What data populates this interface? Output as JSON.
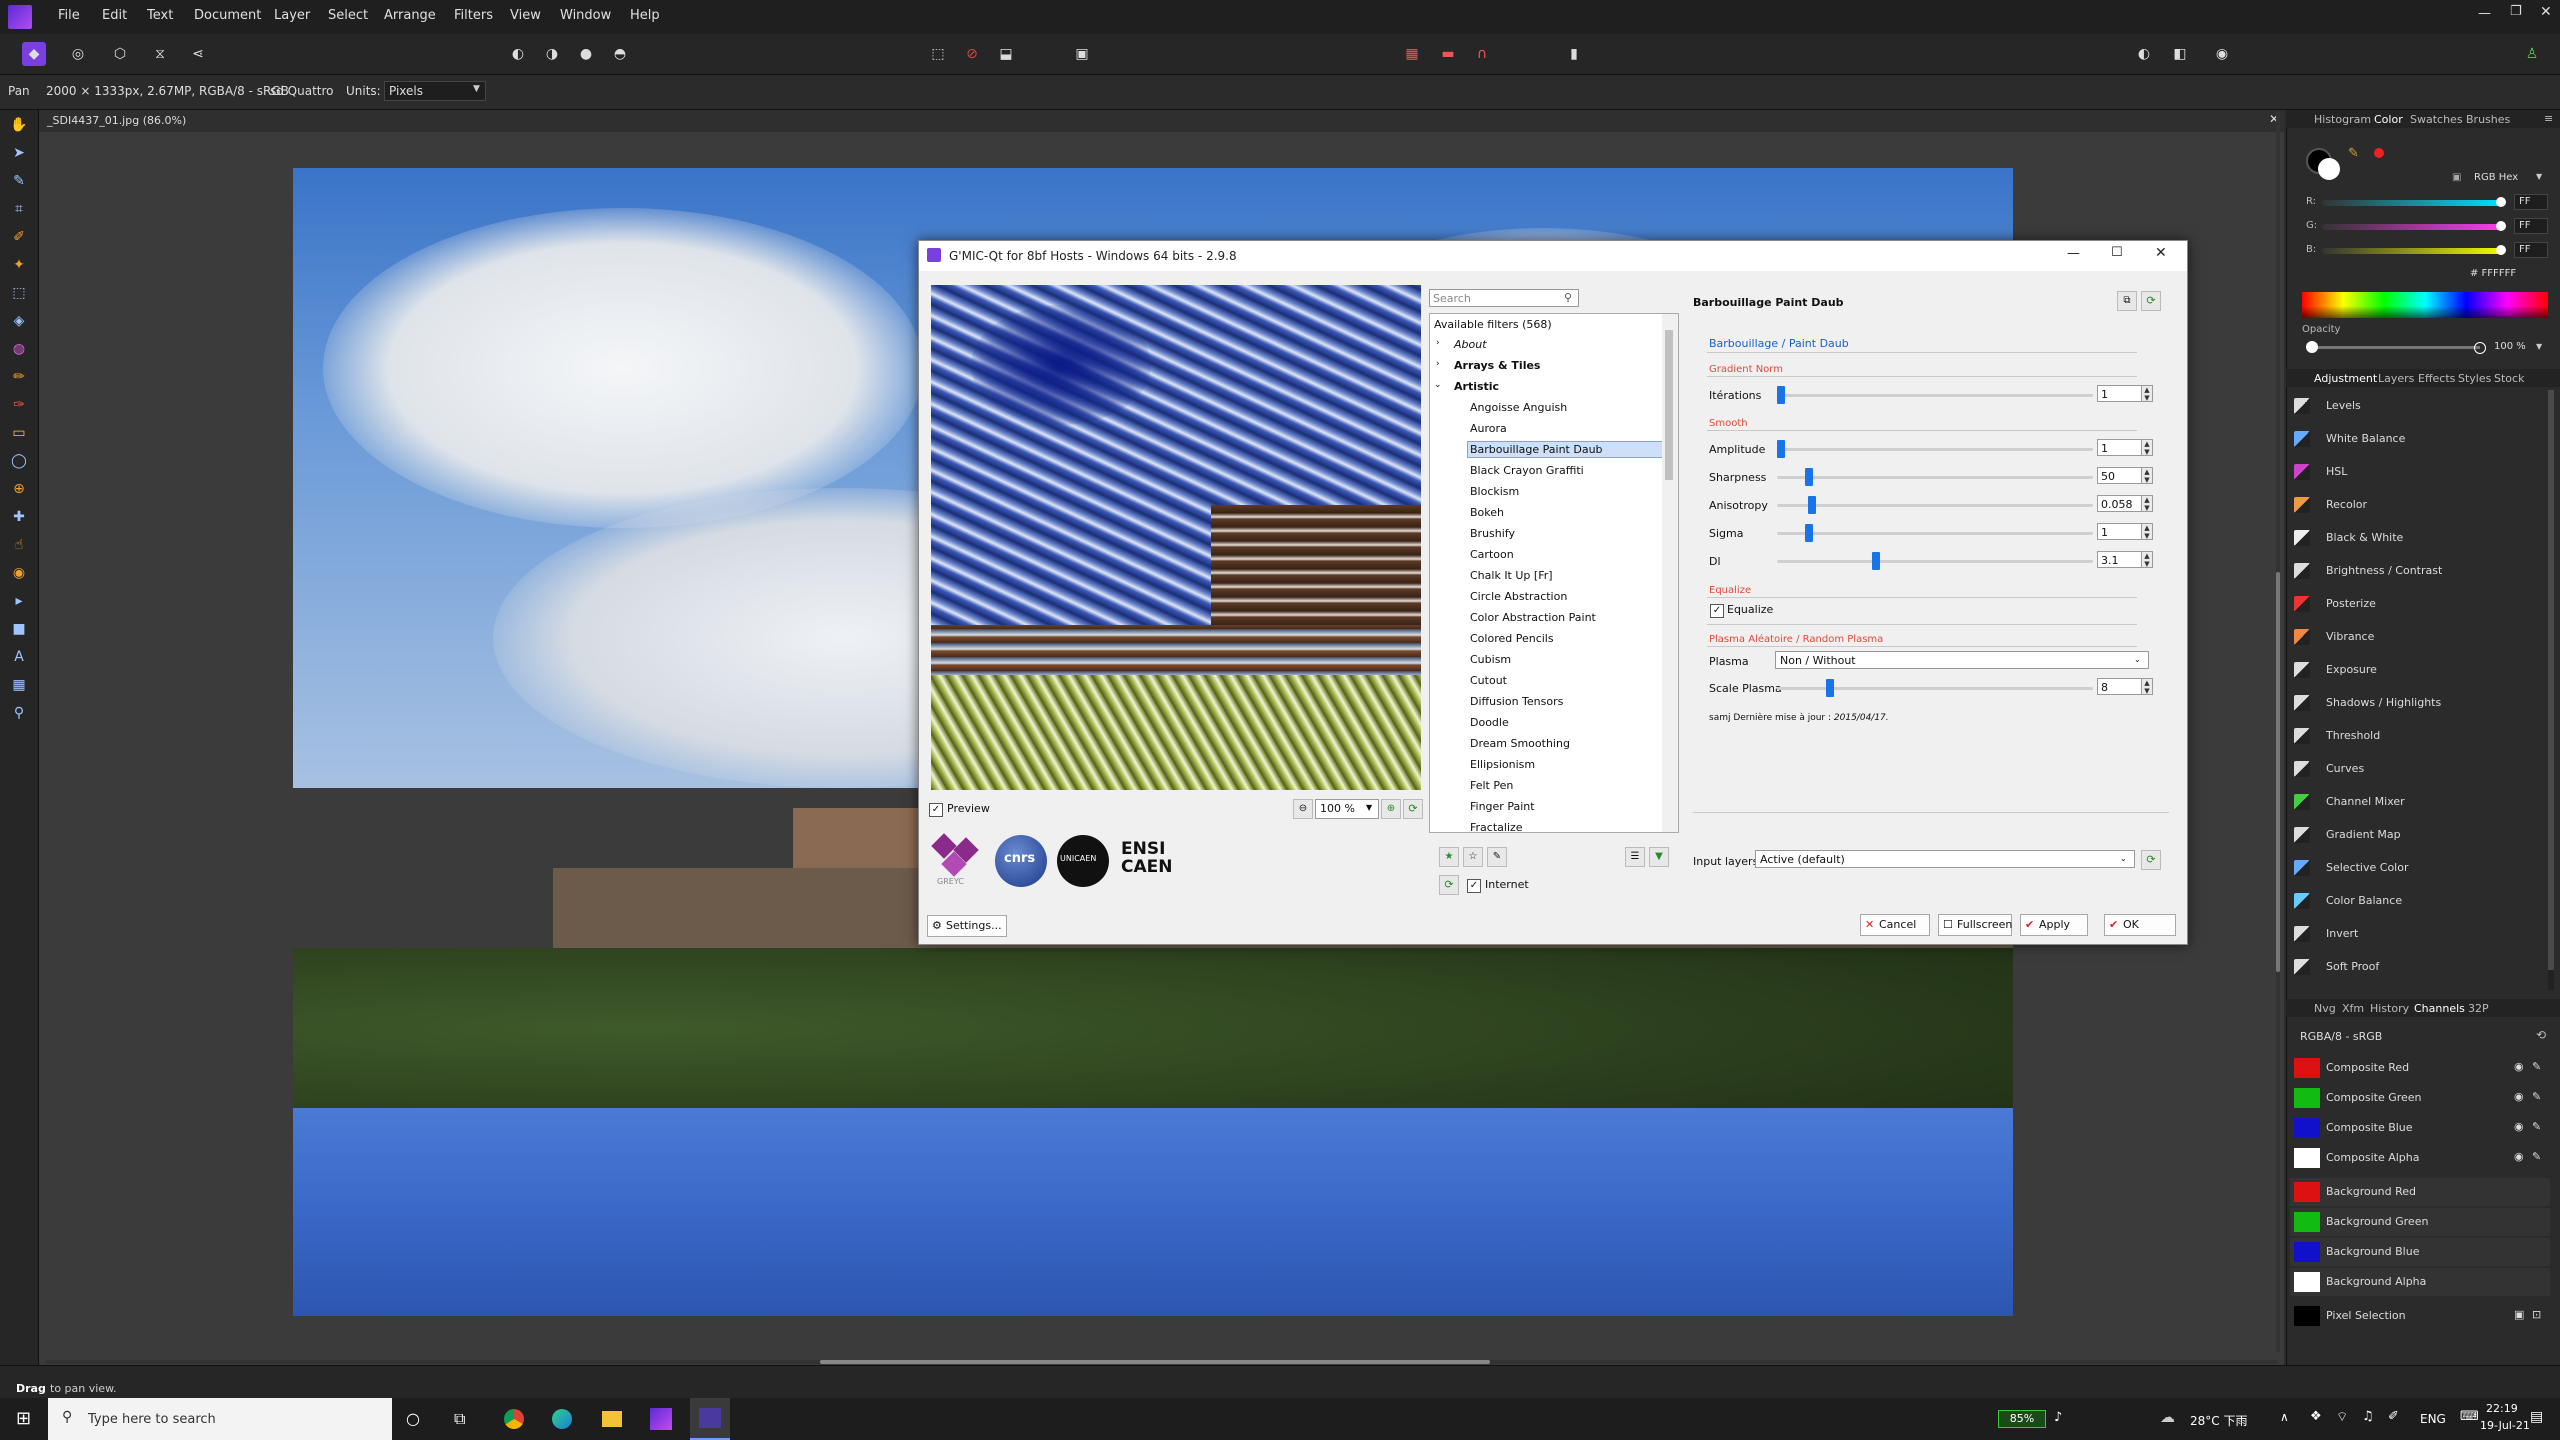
{
  "menubar": {
    "items": [
      "File",
      "Edit",
      "Text",
      "Document",
      "Layer",
      "Select",
      "Arrange",
      "Filters",
      "View",
      "Window",
      "Help"
    ]
  },
  "contextbar": {
    "tool": "Pan",
    "doc_info": "2000 × 1333px, 2.67MP, RGBA/8 - sRGB",
    "camera": "sd Quattro",
    "units_label": "Units:",
    "units_value": "Pixels"
  },
  "doc_tab": "_SDI4437_01.jpg (86.0%)",
  "status": {
    "bold": "Drag",
    "rest": "to pan view."
  },
  "gmic": {
    "title": "G'MIC-Qt for 8bf Hosts - Windows 64 bits - 2.9.8",
    "search_placeholder": "Search",
    "preview_label": "Preview",
    "zoom": "100 %",
    "settings_label": "Settings...",
    "internet_label": "Internet",
    "available": "Available filters (568)",
    "categories": [
      "About",
      "Arrays & Tiles",
      "Artistic"
    ],
    "filters": [
      "Angoisse Anguish",
      "Aurora",
      "Barbouillage Paint Daub",
      "Black Crayon Graffiti",
      "Blockism",
      "Bokeh",
      "Brushify",
      "Cartoon",
      "Chalk It Up [Fr]",
      "Circle Abstraction",
      "Color Abstraction Paint",
      "Colored Pencils",
      "Cubism",
      "Cutout",
      "Diffusion Tensors",
      "Doodle",
      "Dream Smoothing",
      "Ellipsionism",
      "Felt Pen",
      "Finger Paint",
      "Fractalize"
    ],
    "filter_title": "Barbouillage Paint Daub",
    "link": "Barbouillage / Paint Daub",
    "sections": {
      "gradient": "Gradient Norm",
      "smooth": "Smooth",
      "equalize": "Equalize",
      "plasma": "Plasma Aléatoire / Random Plasma"
    },
    "params": [
      {
        "label": "Itérations",
        "value": "1",
        "pos": 0.0
      },
      {
        "label": "Amplitude",
        "value": "1",
        "pos": 0.0
      },
      {
        "label": "Sharpness",
        "value": "50",
        "pos": 0.09
      },
      {
        "label": "Anisotropy",
        "value": "0.058",
        "pos": 0.1
      },
      {
        "label": "Sigma",
        "value": "1",
        "pos": 0.09
      },
      {
        "label": "Dl",
        "value": "3.1",
        "pos": 0.31
      }
    ],
    "equalize_check": "Equalize",
    "plasma_label": "Plasma",
    "plasma_value": "Non / Without",
    "scale_plasma": {
      "label": "Scale Plasma",
      "value": "8",
      "pos": 0.16
    },
    "note_prefix": "samj Dernière mise à jour :",
    "note_date": "2015/04/17.",
    "input_layers_label": "Input layers",
    "input_layers_value": "Active (default)",
    "buttons": {
      "cancel": "Cancel",
      "fullscreen": "Fullscreen",
      "apply": "Apply",
      "ok": "OK"
    },
    "logos": [
      "GREYC",
      "CNRS",
      "UNICAEN",
      "ENSICAEN"
    ],
    "logo_texts": {
      "cnrs": "cnrs",
      "unicaen": "UNICAEN",
      "ensi": "ENSI",
      "caen": "CAEN"
    }
  },
  "right": {
    "top_tabs": [
      "Histogram",
      "Color",
      "Swatches",
      "Brushes"
    ],
    "color_mode": "RGB Hex",
    "rgb": [
      {
        "label": "R:",
        "value": "FF",
        "color": "#00e5ff"
      },
      {
        "label": "G:",
        "value": "FF",
        "color": "#ff3df2"
      },
      {
        "label": "B:",
        "value": "FF",
        "color": "#f5ff00"
      }
    ],
    "hex": "# FFFFFF",
    "opacity_label": "Opacity",
    "opacity_value": "100 %",
    "mid_tabs": [
      "Adjustment",
      "Layers",
      "Effects",
      "Styles",
      "Stock"
    ],
    "adjustments": [
      "Levels",
      "White Balance",
      "HSL",
      "Recolor",
      "Black & White",
      "Brightness / Contrast",
      "Posterize",
      "Vibrance",
      "Exposure",
      "Shadows / Highlights",
      "Threshold",
      "Curves",
      "Channel Mixer",
      "Gradient Map",
      "Selective Color",
      "Color Balance",
      "Invert",
      "Soft Proof"
    ],
    "bottom_tabs": [
      "Nvg",
      "Xfm",
      "History",
      "Channels",
      "32P"
    ],
    "channel_mode": "RGBA/8 - sRGB",
    "channels": [
      {
        "label": "Composite Red",
        "color": "#d11"
      },
      {
        "label": "Composite Green",
        "color": "#1b1"
      },
      {
        "label": "Composite Blue",
        "color": "#11c"
      },
      {
        "label": "Composite Alpha",
        "color": "#fff"
      },
      {
        "label": "Background Red",
        "color": "#d11"
      },
      {
        "label": "Background Green",
        "color": "#1b1"
      },
      {
        "label": "Background Blue",
        "color": "#11c"
      },
      {
        "label": "Background Alpha",
        "color": "#fff"
      },
      {
        "label": "Pixel Selection",
        "color": "#000"
      }
    ]
  },
  "taskbar": {
    "search_placeholder": "Type here to search",
    "battery": "85%",
    "weather": "28°C 下雨",
    "lang": "ENG",
    "time": "22:19",
    "date": "19-Jul-21"
  }
}
